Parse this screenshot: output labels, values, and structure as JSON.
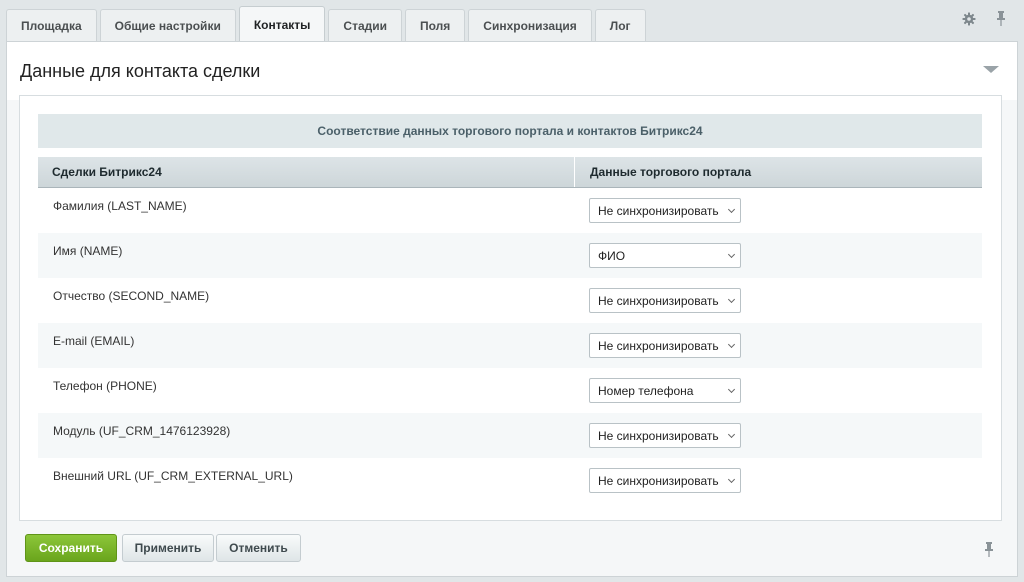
{
  "tabs": [
    {
      "label": "Площадка",
      "active": false
    },
    {
      "label": "Общие настройки",
      "active": false
    },
    {
      "label": "Контакты",
      "active": true
    },
    {
      "label": "Стадии",
      "active": false
    },
    {
      "label": "Поля",
      "active": false
    },
    {
      "label": "Синхронизация",
      "active": false
    },
    {
      "label": "Лог",
      "active": false
    }
  ],
  "tab_icons": [
    "gear-icon",
    "pin-icon"
  ],
  "panel": {
    "title": "Данные для контакта сделки",
    "collapse_icon": "chevron-down-icon"
  },
  "table": {
    "caption": "Соответствие данных торгового портала и контактов Битрикс24",
    "headers": [
      "Сделки Битрикс24",
      "Данные торгового портала"
    ],
    "rows": [
      {
        "label": "Фамилия (LAST_NAME)",
        "value": "Не синхронизировать"
      },
      {
        "label": "Имя (NAME)",
        "value": "ФИО"
      },
      {
        "label": "Отчество (SECOND_NAME)",
        "value": "Не синхронизировать"
      },
      {
        "label": "E-mail (EMAIL)",
        "value": "Не синхронизировать"
      },
      {
        "label": "Телефон (PHONE)",
        "value": "Номер телефона"
      },
      {
        "label": "Модуль (UF_CRM_1476123928)",
        "value": "Не синхронизировать"
      },
      {
        "label": "Внешний URL (UF_CRM_EXTERNAL_URL)",
        "value": "Не синхронизировать"
      }
    ]
  },
  "footer": {
    "save_label": "Сохранить",
    "apply_label": "Применить",
    "cancel_label": "Отменить"
  },
  "colors": {
    "accent_green": "#7ab62a",
    "background": "#e1e6e8"
  }
}
